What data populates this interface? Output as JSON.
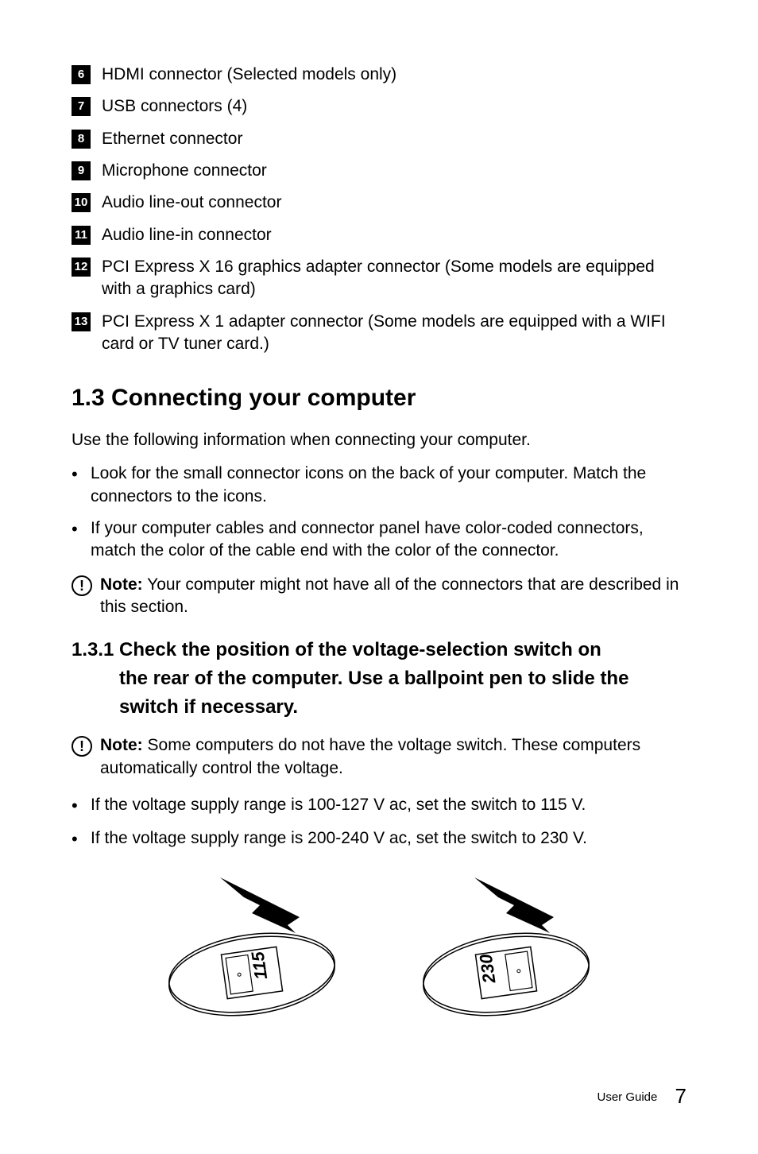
{
  "connector_list": [
    {
      "num": "6",
      "text": "HDMI connector (Selected models only)"
    },
    {
      "num": "7",
      "text": "USB connectors (4)"
    },
    {
      "num": "8",
      "text": "Ethernet connector"
    },
    {
      "num": "9",
      "text": "Microphone connector"
    },
    {
      "num": "10",
      "text": "Audio line-out connector"
    },
    {
      "num": "11",
      "text": "Audio line-in connector"
    },
    {
      "num": "12",
      "text": "PCI Express X 16 graphics adapter connector (Some models are equipped with a graphics card)"
    },
    {
      "num": "13",
      "text": "PCI Express X 1 adapter connector (Some models are equipped with a WIFI card or TV tuner card.)"
    }
  ],
  "section_1_3": {
    "heading": "1.3 Connecting your computer",
    "intro": "Use the following information when connecting your computer.",
    "bullets": [
      "Look for the small connector icons on the back of your computer. Match the connectors to the icons.",
      "If your computer cables and connector panel have color-coded connectors, match the color of the cable end with the color of the connector."
    ],
    "note_label": "Note:",
    "note_text": " Your computer might not have all of the connectors that are described in this section."
  },
  "section_1_3_1": {
    "heading_line1": "1.3.1 Check the position of the voltage-selection switch on",
    "heading_line2": "the rear of the computer. Use a ballpoint pen to slide the switch if necessary.",
    "note_label": "Note:",
    "note_text": " Some computers do not have the voltage switch. These computers automatically control the voltage.",
    "bullets": [
      "If the voltage supply range is 100-127 V ac, set the switch to 115 V.",
      "If the voltage supply range is 200-240 V ac, set the switch to 230 V."
    ],
    "switch_labels": {
      "left": "115",
      "right": "230"
    }
  },
  "footer": {
    "label": "User Guide",
    "page": "7"
  }
}
